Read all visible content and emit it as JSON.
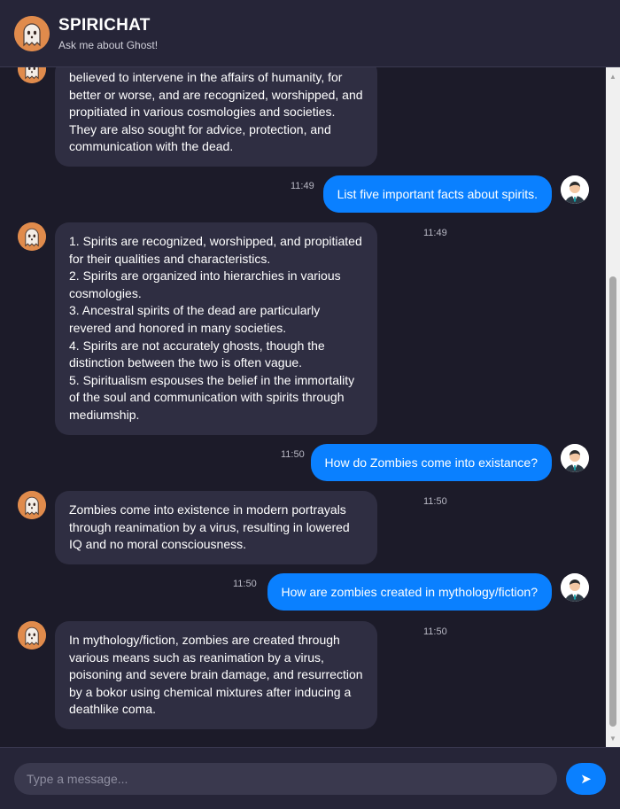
{
  "header": {
    "title": "SPIRICHAT",
    "subtitle": "Ask me about Ghost!"
  },
  "messages": [
    {
      "sender": "bot",
      "time": "",
      "text": "believed to intervene in the affairs of humanity, for better or worse, and are recognized, worshipped, and propitiated in various cosmologies and societies. They are also sought for advice, protection, and communication with the dead."
    },
    {
      "sender": "user",
      "time": "11:49",
      "text": "List five important facts about spirits."
    },
    {
      "sender": "bot",
      "time": "11:49",
      "lines": [
        "1. Spirits are recognized, worshipped, and propitiated for their qualities and characteristics.",
        "2. Spirits are organized into hierarchies in various cosmologies.",
        "3. Ancestral spirits of the dead are particularly revered and honored in many societies.",
        "4. Spirits are not accurately ghosts, though the distinction between the two is often vague.",
        "5. Spiritualism espouses the belief in the immortality of the soul and communication with spirits through mediumship."
      ]
    },
    {
      "sender": "user",
      "time": "11:50",
      "text": "How do Zombies come into existance?"
    },
    {
      "sender": "bot",
      "time": "11:50",
      "text": "Zombies come into existence in modern portrayals through reanimation by a virus, resulting in lowered IQ and no moral consciousness."
    },
    {
      "sender": "user",
      "time": "11:50",
      "text": "How are zombies created in mythology/fiction?"
    },
    {
      "sender": "bot",
      "time": "11:50",
      "text": "In mythology/fiction, zombies are created through various means such as reanimation by a virus, poisoning and severe brain damage, and resurrection by a bokor using chemical mixtures after inducing a deathlike coma."
    }
  ],
  "composer": {
    "placeholder": "Type a message...",
    "send_icon": "send-arrow-icon"
  },
  "colors": {
    "background": "#1c1b29",
    "header": "#262538",
    "bot_bubble": "#2f2e42",
    "user_bubble": "#0a80ff",
    "avatar_bot": "#e08b4c"
  }
}
